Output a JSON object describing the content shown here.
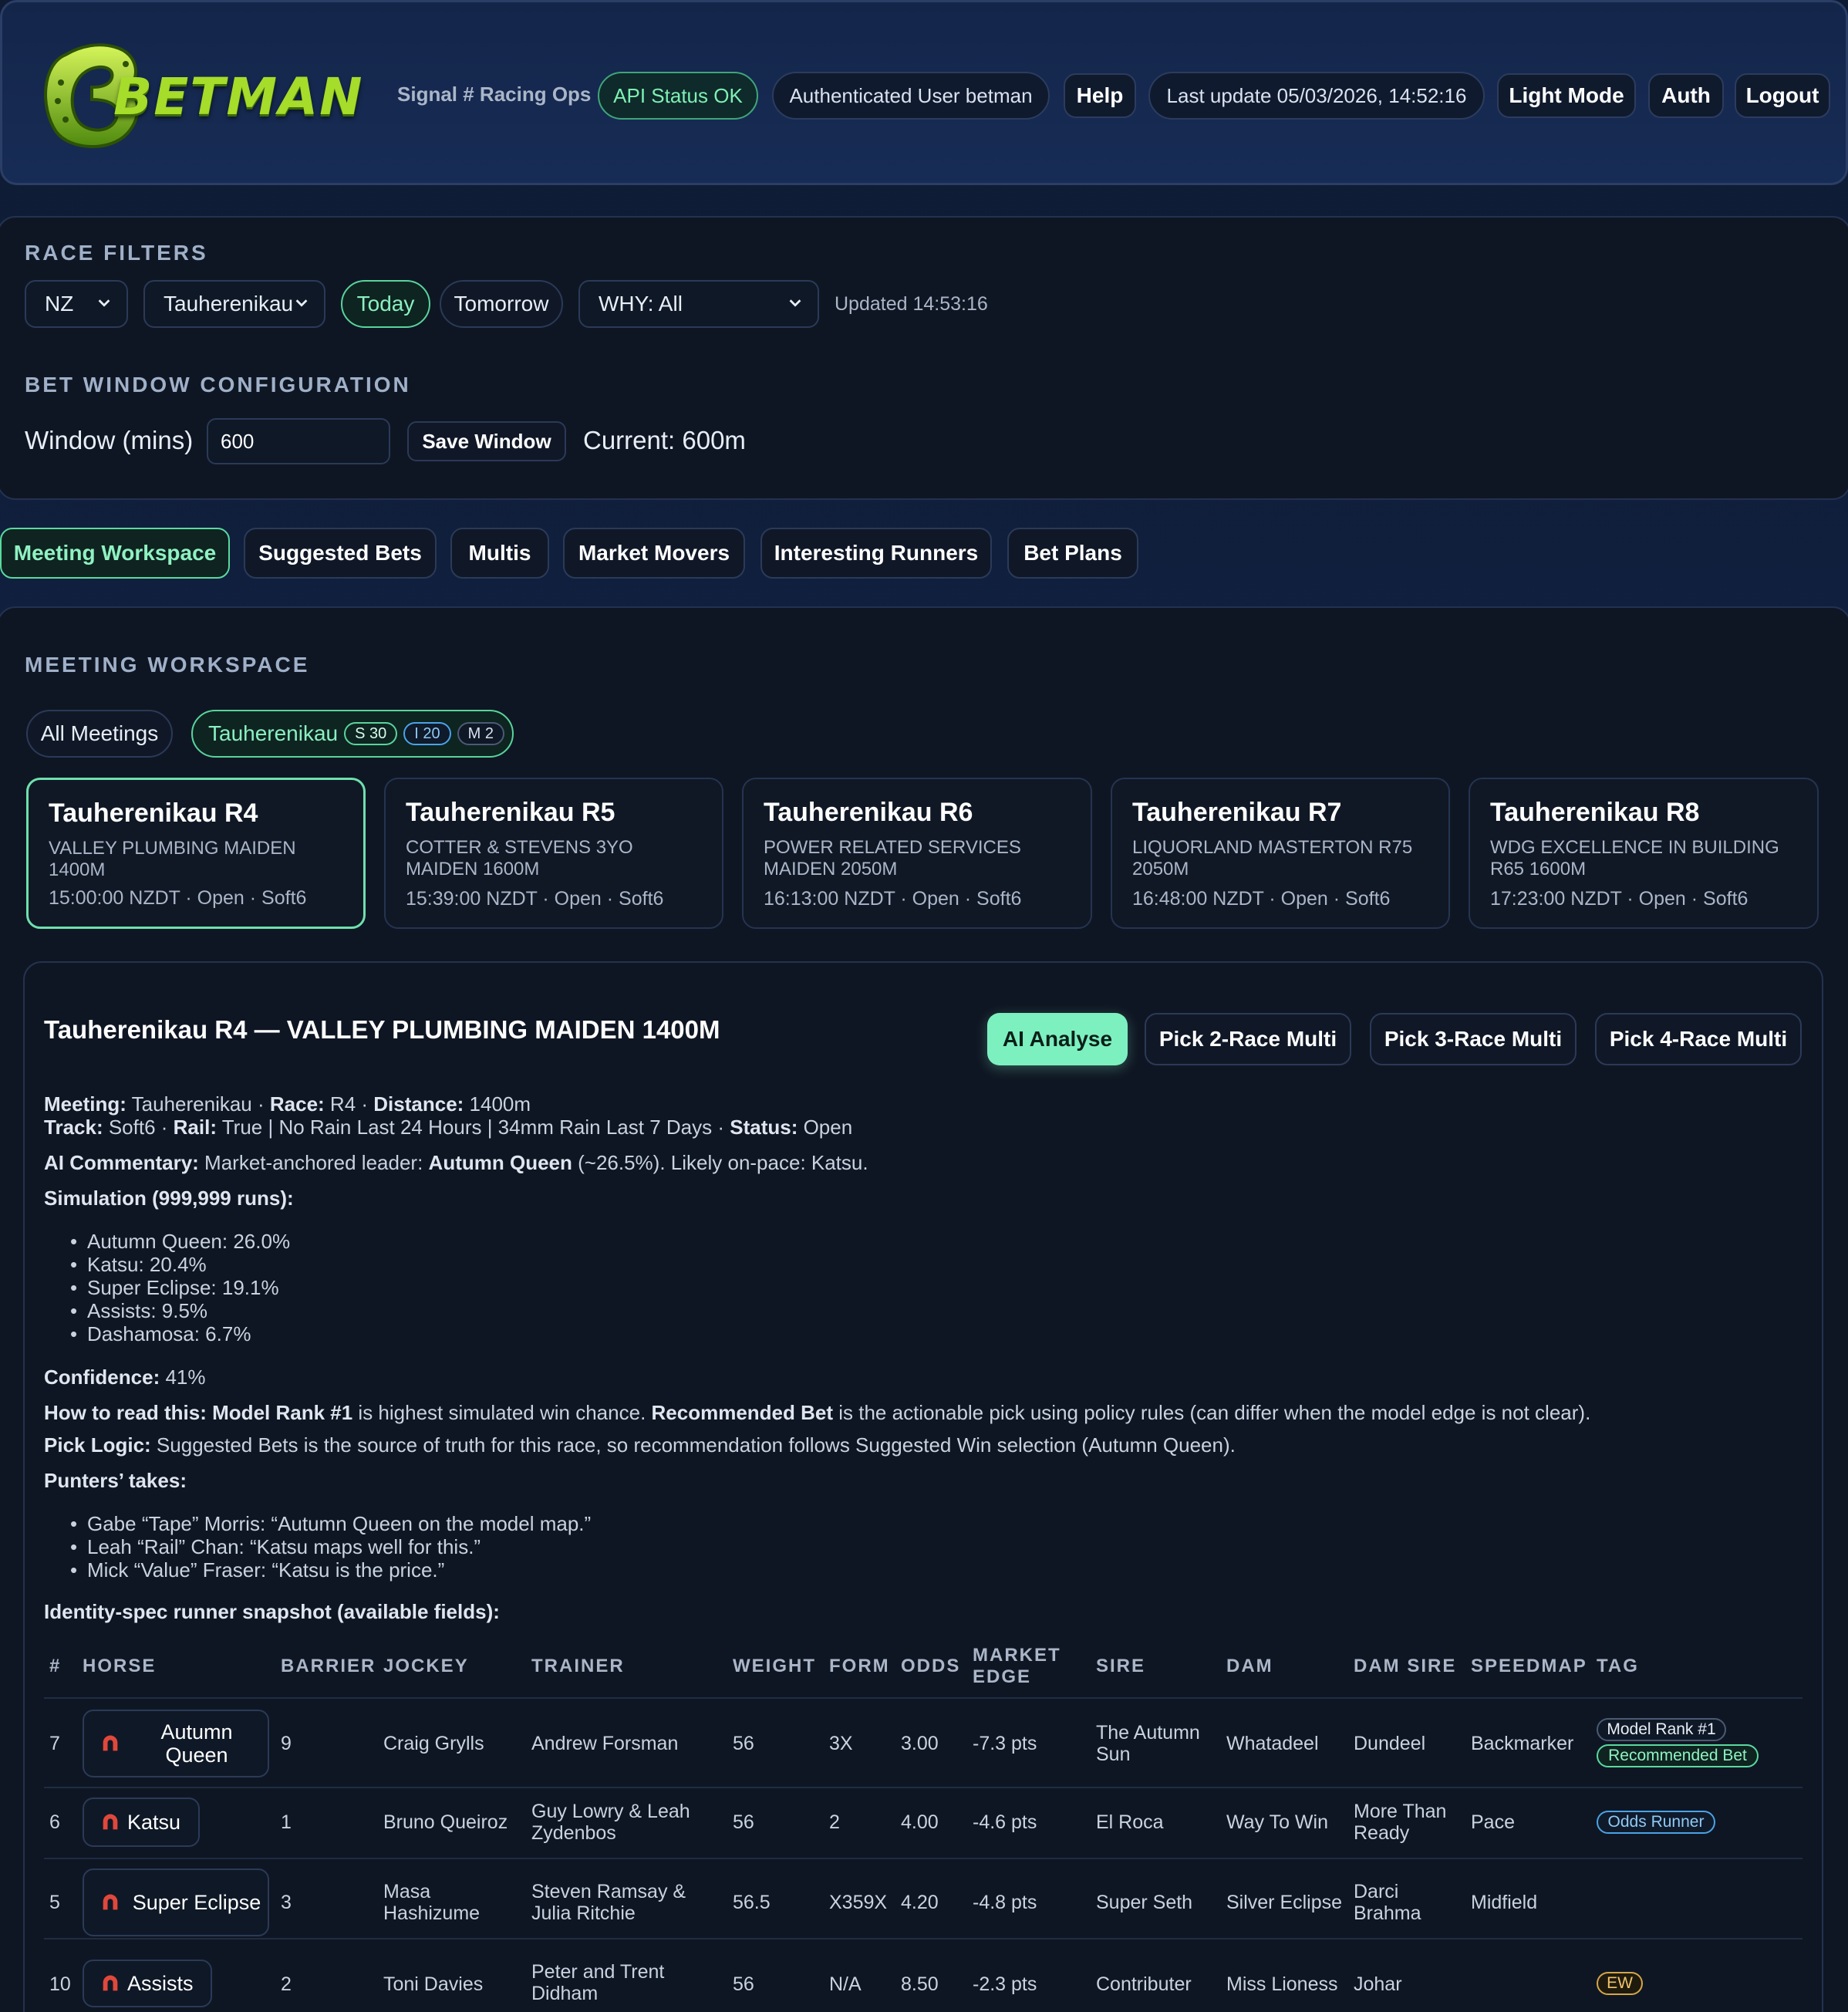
{
  "header": {
    "logo_text": "BETMAN",
    "tagline": "Signal # Racing Ops",
    "api_status": "API Status OK",
    "auth_user": "Authenticated User betman",
    "help": "Help",
    "last_update": "Last update 05/03/2026, 14:52:16",
    "light_mode": "Light Mode",
    "auth": "Auth",
    "logout": "Logout"
  },
  "filters": {
    "title": "RACE FILTERS",
    "country": "NZ",
    "meeting": "Tauherenikau",
    "today": "Today",
    "tomorrow": "Tomorrow",
    "why": "WHY: All",
    "updated": "Updated 14:53:16"
  },
  "bet_window": {
    "title": "BET WINDOW CONFIGURATION",
    "label": "Window (mins)",
    "value": "600",
    "save": "Save Window",
    "current": "Current: 600m"
  },
  "tabs": [
    "Meeting Workspace",
    "Suggested Bets",
    "Multis",
    "Market Movers",
    "Interesting Runners",
    "Bet Plans"
  ],
  "workspace": {
    "title": "MEETING WORKSPACE",
    "all_meetings": "All Meetings",
    "meeting_chip": "Tauherenikau",
    "badges": [
      "S 30",
      "I 20",
      "M 2"
    ]
  },
  "races": [
    {
      "title": "Tauherenikau R4",
      "name": "VALLEY PLUMBING MAIDEN 1400M",
      "meta": "15:00:00 NZDT · Open · Soft6"
    },
    {
      "title": "Tauherenikau R5",
      "name": "COTTER & STEVENS 3YO MAIDEN 1600M",
      "meta": "15:39:00 NZDT · Open · Soft6"
    },
    {
      "title": "Tauherenikau R6",
      "name": "POWER RELATED SERVICES MAIDEN 2050M",
      "meta": "16:13:00 NZDT · Open · Soft6"
    },
    {
      "title": "Tauherenikau R7",
      "name": "LIQUORLAND MASTERTON R75 2050M",
      "meta": "16:48:00 NZDT · Open · Soft6"
    },
    {
      "title": "Tauherenikau R8",
      "name": "WDG EXCELLENCE IN BUILDING R65 1600M",
      "meta": "17:23:00 NZDT · Open · Soft6"
    }
  ],
  "detail": {
    "title": "Tauherenikau R4 — VALLEY PLUMBING MAIDEN 1400M",
    "actions": [
      "AI Analyse",
      "Pick 2-Race Multi",
      "Pick 3-Race Multi",
      "Pick 4-Race Multi"
    ],
    "meeting_label": "Meeting:",
    "meeting_value": " Tauherenikau · ",
    "race_label": "Race:",
    "race_value": " R4 · ",
    "distance_label": "Distance:",
    "distance_value": " 1400m",
    "track_label": "Track:",
    "track_value": " Soft6 · ",
    "rail_label": "Rail:",
    "rail_value": " True | No Rain Last 24 Hours | 34mm Rain Last 7 Days · ",
    "status_label": "Status:",
    "status_value": " Open",
    "commentary_label": "AI Commentary:",
    "commentary_pre": " Market-anchored leader: ",
    "commentary_bold": "Autumn Queen",
    "commentary_post": " (~26.5%). Likely on-pace: Katsu.",
    "simulation_label": "Simulation (999,999 runs):",
    "simulation": [
      "Autumn Queen: 26.0%",
      "Katsu: 20.4%",
      "Super Eclipse: 19.1%",
      "Assists: 9.5%",
      "Dashamosa: 6.7%"
    ],
    "confidence_label": "Confidence:",
    "confidence_value": " 41%",
    "howto_label": "How to read this:",
    "howto_b1": "Model Rank #1",
    "howto_t1": " is highest simulated win chance. ",
    "howto_b2": "Recommended Bet",
    "howto_t2": " is the actionable pick using policy rules (can differ when the model edge is not clear).",
    "pick_label": "Pick Logic:",
    "pick_value": " Suggested Bets is the source of truth for this race, so recommendation follows Suggested Win selection (Autumn Queen).",
    "punters_label": "Punters’ takes:",
    "punters": [
      "Gabe “Tape” Morris: “Autumn Queen on the model map.”",
      "Leah “Rail” Chan: “Katsu maps well for this.”",
      "Mick “Value” Fraser: “Katsu is the price.”"
    ],
    "snapshot_label": "Identity-spec runner snapshot (available fields):"
  },
  "table": {
    "headers": [
      "#",
      "HORSE",
      "BARRIER",
      "JOCKEY",
      "TRAINER",
      "WEIGHT",
      "FORM",
      "ODDS",
      "MARKET EDGE",
      "SIRE",
      "DAM",
      "DAM SIRE",
      "SPEEDMAP",
      "TAG"
    ],
    "rows": [
      {
        "num": "7",
        "horse": "Autumn Queen",
        "barrier": "9",
        "jockey": "Craig Grylls",
        "trainer": "Andrew Forsman",
        "weight": "56",
        "form": "3X",
        "odds": "3.00",
        "edge": "-7.3 pts",
        "sire": "The Autumn Sun",
        "dam": "Whatadeel",
        "damsire": "Dundeel",
        "speedmap": "Backmarker",
        "tags": [
          "Model Rank #1",
          "Recommended Bet"
        ]
      },
      {
        "num": "6",
        "horse": "Katsu",
        "barrier": "1",
        "jockey": "Bruno Queiroz",
        "trainer": "Guy Lowry & Leah Zydenbos",
        "weight": "56",
        "form": "2",
        "odds": "4.00",
        "edge": "-4.6 pts",
        "sire": "El Roca",
        "dam": "Way To Win",
        "damsire": "More Than Ready",
        "speedmap": "Pace",
        "tags": [
          "Odds Runner"
        ]
      },
      {
        "num": "5",
        "horse": "Super Eclipse",
        "barrier": "3",
        "jockey": "Masa Hashizume",
        "trainer": "Steven Ramsay & Julia Ritchie",
        "weight": "56.5",
        "form": "X359X",
        "odds": "4.20",
        "edge": "-4.8 pts",
        "sire": "Super Seth",
        "dam": "Silver Eclipse",
        "damsire": "Darci Brahma",
        "speedmap": "Midfield",
        "tags": []
      },
      {
        "num": "10",
        "horse": "Assists",
        "barrier": "2",
        "jockey": "Toni Davies",
        "trainer": "Peter and Trent Didham",
        "weight": "56",
        "form": "N/A",
        "odds": "8.50",
        "edge": "-2.3 pts",
        "sire": "Contributer",
        "dam": "Miss Lioness",
        "damsire": "Johar",
        "speedmap": "",
        "tags": [
          "EW"
        ]
      }
    ]
  },
  "colors": {
    "accent": "#7df0c0",
    "logo": "#a6dc2a",
    "background": "#0f1b33"
  }
}
